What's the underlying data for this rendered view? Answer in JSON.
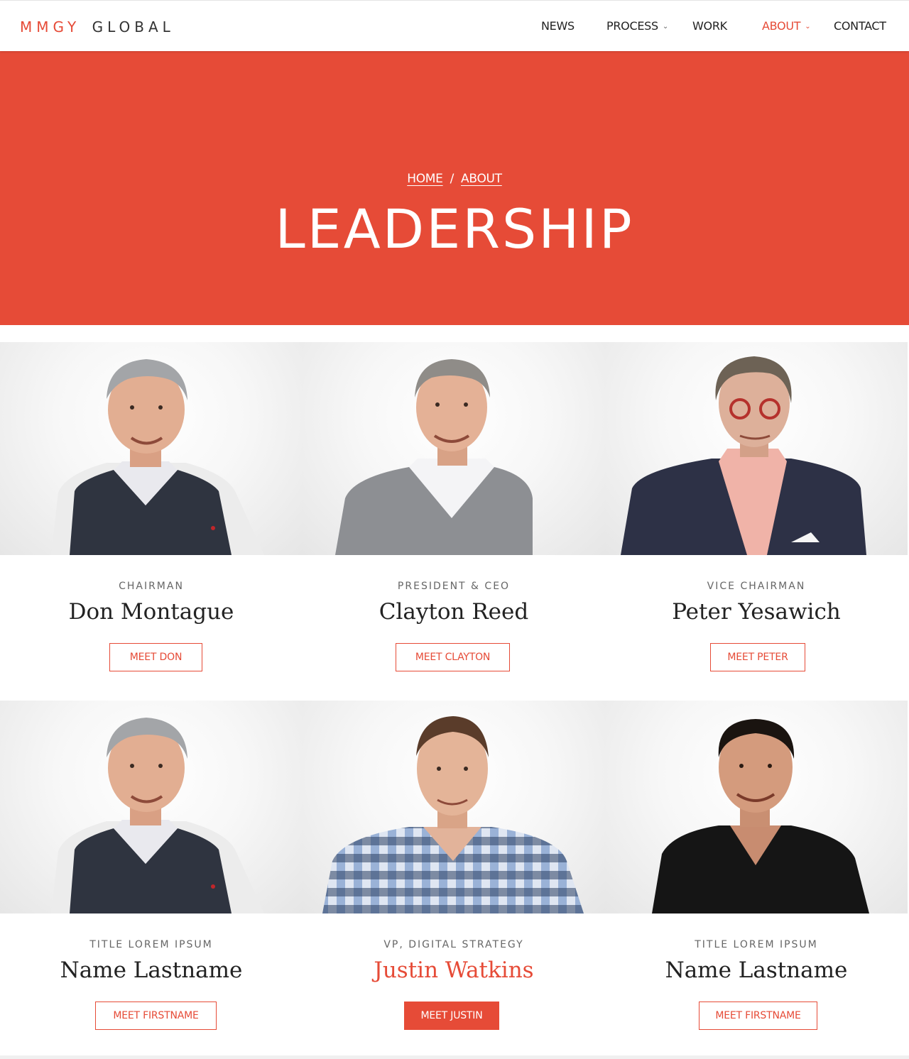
{
  "brand": {
    "logo_part1": "MMGY",
    "logo_part2": "GLOBAL",
    "accent": "#e64b37"
  },
  "nav": {
    "news": "NEWS",
    "process": "PROCESS",
    "work": "WORK",
    "about": "ABOUT",
    "contact": "CONTACT",
    "caret": "⌄"
  },
  "hero": {
    "breadcrumb_home": "HOME",
    "breadcrumb_sep": "/",
    "breadcrumb_about": "ABOUT",
    "title": "LEADERSHIP"
  },
  "people": [
    {
      "role": "CHAIRMAN",
      "name": "Don Montague",
      "button": "MEET DON"
    },
    {
      "role": "PRESIDENT & CEO",
      "name": "Clayton Reed",
      "button": "MEET CLAYTON"
    },
    {
      "role": "VICE CHAIRMAN",
      "name": "Peter Yesawich",
      "button": "MEET PETER"
    },
    {
      "role": "TITLE LOREM IPSUM",
      "name": "Name Lastname",
      "button": "MEET FIRSTNAME"
    },
    {
      "role": "VP, DIGITAL STRATEGY",
      "name": "Justin Watkins",
      "button": "MEET JUSTIN"
    },
    {
      "role": "TITLE LOREM IPSUM",
      "name": "Name Lastname",
      "button": "MEET FIRSTNAME"
    }
  ]
}
